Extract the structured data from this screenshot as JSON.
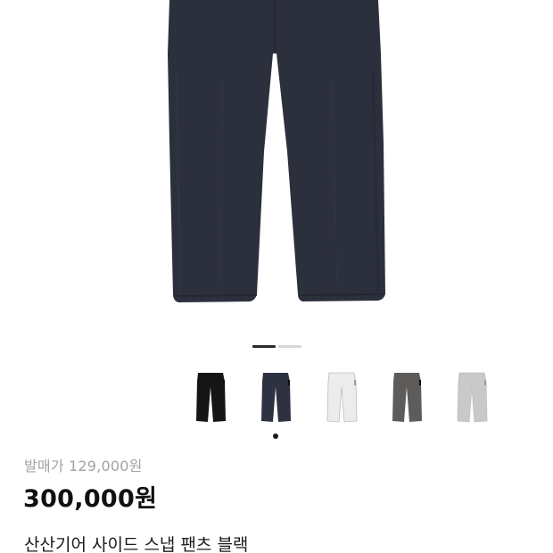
{
  "product": {
    "image_alt": "navy pants front view",
    "gallery": {
      "total_pages": 2,
      "active_page": 1
    },
    "color_options": [
      {
        "name": "black-pants-thumb",
        "color": "#151515"
      },
      {
        "name": "navy-pants-thumb",
        "color": "#2e3140",
        "selected": true
      },
      {
        "name": "white-pants-thumb",
        "color": "#ececec"
      },
      {
        "name": "charcoal-pants-thumb",
        "color": "#5e5c5b"
      },
      {
        "name": "light-gray-pants-thumb",
        "color": "#c9c9c9"
      }
    ],
    "original_price_text": "발매가 129,000원",
    "price_text": "300,000원",
    "title": "산산기어 사이드 스냅 팬츠 블랙"
  },
  "colors": {
    "main_pants": "#2c2f3c",
    "background": "#ffffff",
    "muted_text": "#a3a3a3"
  }
}
